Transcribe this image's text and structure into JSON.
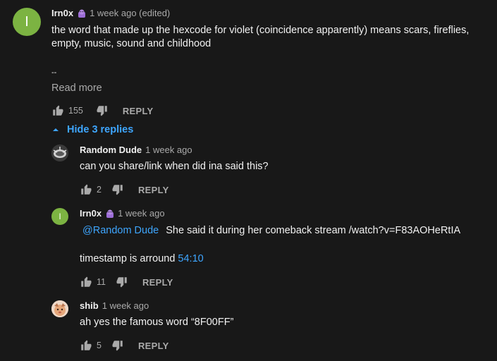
{
  "comment": {
    "avatar_letter": "I",
    "author": "Irn0x",
    "time": "1 week ago (edited)",
    "text_line1": "the word that made up the hexcode for violet (coincidence apparently) means scars, fireflies,",
    "text_line2": "empty, music, sound and childhood",
    "text_line3": "--",
    "read_more": "Read more",
    "likes": "155",
    "reply_label": "REPLY"
  },
  "hide_replies_label": "Hide 3 replies",
  "replies": [
    {
      "author": "Random Dude",
      "time": "1 week ago",
      "text": "can you share/link when did ina said this?",
      "likes": "2",
      "reply_label": "REPLY"
    },
    {
      "avatar_letter": "I",
      "author": "Irn0x",
      "time": "1 week ago",
      "mention": "@Random Dude",
      "text": "She said it during her comeback stream /watch?v=F83AOHeRtIA",
      "timestamp_prefix": "timestamp is arround ",
      "timestamp": "54:10",
      "likes": "11",
      "reply_label": "REPLY"
    },
    {
      "author": "shib",
      "time": "1 week ago",
      "text": "ah yes the famous word “8F00FF”",
      "likes": "5",
      "reply_label": "REPLY"
    }
  ],
  "colors": {
    "background": "#181818",
    "link": "#3ea6ff",
    "secondary_text": "#aaaaaa",
    "avatar_green": "#7cb342"
  },
  "icons": {
    "badge": "member-badge-icon",
    "like": "thumbs-up-icon",
    "dislike": "thumbs-down-icon",
    "caret": "caret-up-icon"
  }
}
